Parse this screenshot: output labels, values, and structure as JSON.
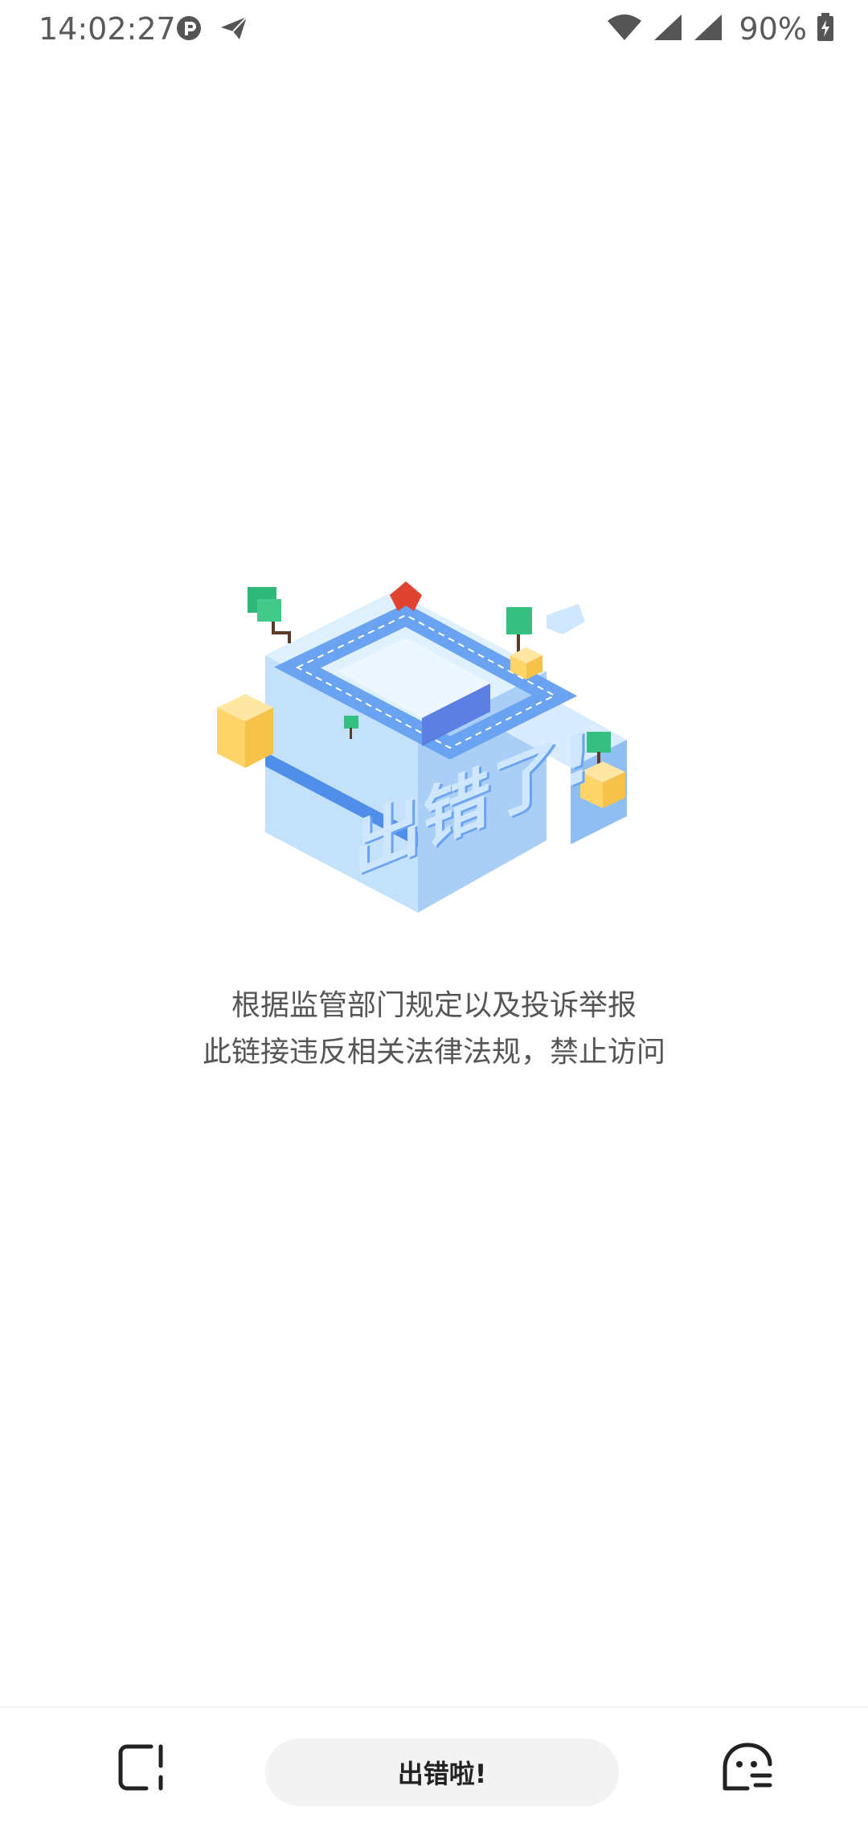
{
  "status_bar": {
    "time": "14:02:27",
    "battery": "90%",
    "icons": [
      "p-app-icon",
      "send-icon",
      "wifi-icon",
      "signal-icon",
      "signal-icon",
      "battery-charging-icon"
    ]
  },
  "illustration": {
    "caption": "出错了!"
  },
  "message": {
    "line1": "根据监管部门规定以及投诉举报",
    "line2": "此链接违反相关法律法规，禁止访问"
  },
  "bottom_bar": {
    "title": "出错啦!",
    "left_icon": "square-frame-icon",
    "right_icon": "smile-face-icon"
  },
  "colors": {
    "accent_blue": "#5b8cf0",
    "text_gray": "#555555",
    "pill_bg": "#f3f3f3"
  }
}
